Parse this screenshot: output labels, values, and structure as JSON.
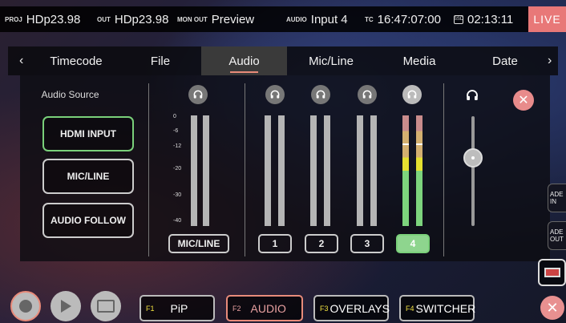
{
  "status_bar": {
    "proj_key": "PROJ",
    "proj_val": "HDp23.98",
    "out_key": "OUT",
    "out_val": "HDp23.98",
    "monout_key": "MON OUT",
    "monout_val": "Preview",
    "audio_key": "AUDIO",
    "audio_val": "Input 4",
    "tc_key": "TC",
    "tc_val": "16:47:07:00",
    "sd_key": "SSD",
    "sd_val": "02:13:11",
    "live": "LIVE"
  },
  "tabs": [
    {
      "label": "Timecode"
    },
    {
      "label": "File"
    },
    {
      "label": "Audio",
      "active": true
    },
    {
      "label": "Mic/Line"
    },
    {
      "label": "Media"
    },
    {
      "label": "Date"
    }
  ],
  "nav": {
    "prev": "‹",
    "next": "›"
  },
  "audio_source": {
    "title": "Audio Source",
    "options": [
      {
        "label": "HDMI INPUT",
        "selected": true
      },
      {
        "label": "MIC/LINE"
      },
      {
        "label": "AUDIO FOLLOW"
      }
    ]
  },
  "meter_scale": [
    "0",
    "-6",
    "-12",
    "-20",
    "-30",
    "-40"
  ],
  "channels": [
    {
      "label": "MIC/LINE"
    },
    {
      "label": "1"
    },
    {
      "label": "2"
    },
    {
      "label": "3"
    },
    {
      "label": "4",
      "selected": true
    }
  ],
  "headphone_volume": {
    "icon": "headphones-icon",
    "level": 0.62
  },
  "side_buttons": {
    "fade_in": "ADE IN",
    "fade_out": "ADE OUT"
  },
  "function_keys": [
    {
      "key": "F1",
      "label": "PiP"
    },
    {
      "key": "F2",
      "label": "AUDIO",
      "active": true
    },
    {
      "key": "F3",
      "label": "OVERLAYS"
    },
    {
      "key": "F4",
      "label": "SWITCHER"
    }
  ],
  "colors": {
    "accent": "#e88b7a",
    "selected": "#7ad07a",
    "live": "#e87878",
    "fkey": "#f0e040"
  }
}
